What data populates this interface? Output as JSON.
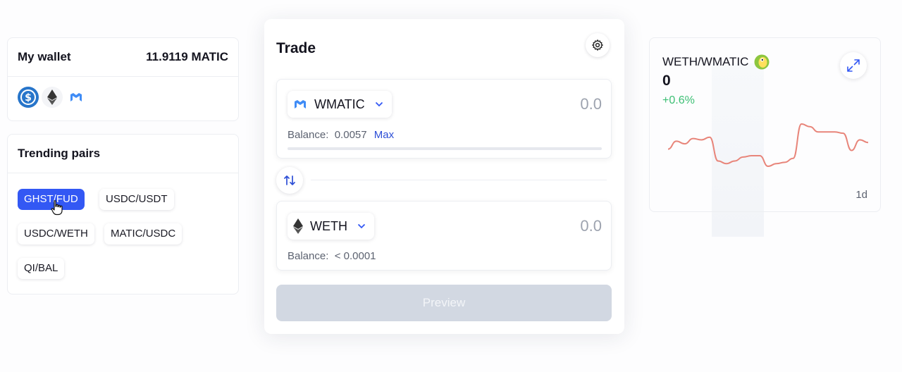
{
  "wallet": {
    "title": "My wallet",
    "balance": "11.9119 MATIC",
    "tokens": [
      "usdc-icon",
      "ethereum-icon",
      "matic-icon"
    ]
  },
  "trending": {
    "title": "Trending pairs",
    "pairs": [
      "GHST/FUD",
      "USDC/USDT",
      "USDC/WETH",
      "MATIC/USDC",
      "QI/BAL"
    ],
    "active_index": 0
  },
  "trade": {
    "title": "Trade",
    "from": {
      "token": "WMATIC",
      "amount": "0.0",
      "balance_label": "Balance:",
      "balance": "0.0057",
      "max_label": "Max"
    },
    "to": {
      "token": "WETH",
      "amount": "0.0",
      "balance_label": "Balance:",
      "balance": "< 0.0001"
    },
    "preview_label": "Preview"
  },
  "chart_panel": {
    "pair": "WETH/WMATIC",
    "price": "0",
    "change": "+0.6%",
    "range": "1d",
    "line_color": "#e8857a",
    "positive_color": "#3cbf74"
  },
  "colors": {
    "accent": "#3358f4",
    "disabled_button": "#d2d8e2"
  },
  "chart_data": {
    "type": "line",
    "series": [
      {
        "values": [
          3,
          9,
          7,
          11,
          10,
          12,
          -6,
          -8,
          -6,
          -3,
          -2,
          -2,
          -10,
          -8,
          -7,
          -4,
          22,
          20,
          16,
          16,
          16,
          15,
          2,
          10,
          8
        ]
      }
    ],
    "grid": false
  }
}
